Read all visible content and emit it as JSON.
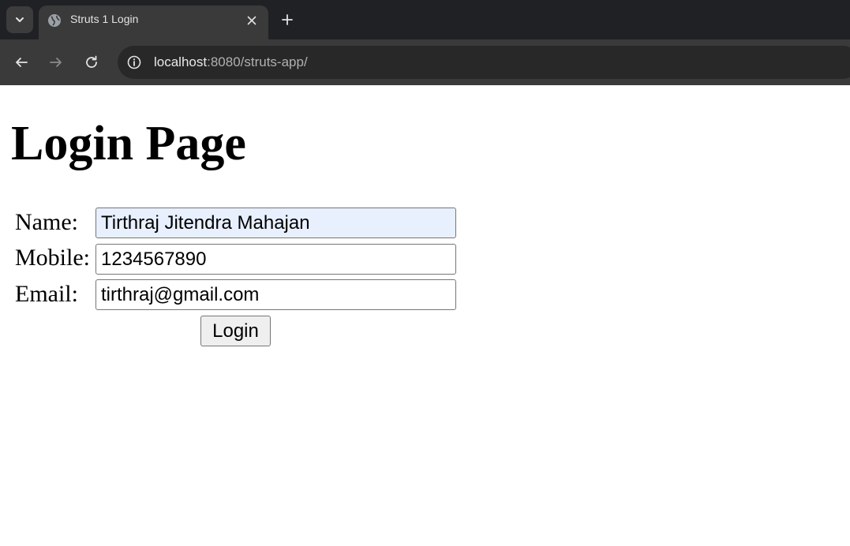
{
  "browser": {
    "tab": {
      "title": "Struts 1 Login"
    },
    "address_bar": {
      "host": "localhost",
      "rest": ":8080/struts-app/"
    },
    "icons": {
      "tab_search": "chevron-down-icon",
      "favicon": "globe-icon",
      "tab_close": "close-icon",
      "new_tab": "plus-icon",
      "back": "arrow-left-icon",
      "forward": "arrow-right-icon",
      "reload": "reload-icon",
      "site_info": "info-icon"
    }
  },
  "page": {
    "title": "Login Page",
    "form": {
      "name": {
        "label": "Name:",
        "value": "Tirthraj Jitendra Mahajan"
      },
      "mobile": {
        "label": "Mobile:",
        "value": "1234567890"
      },
      "email": {
        "label": "Email:",
        "value": "tirthraj@gmail.com"
      },
      "submit_label": "Login"
    }
  },
  "colors": {
    "tabstrip_bg": "#202124",
    "toolbar_bg": "#3a3a3a",
    "omnibox_bg": "#282828",
    "autofill_bg": "#e8f0fe"
  }
}
